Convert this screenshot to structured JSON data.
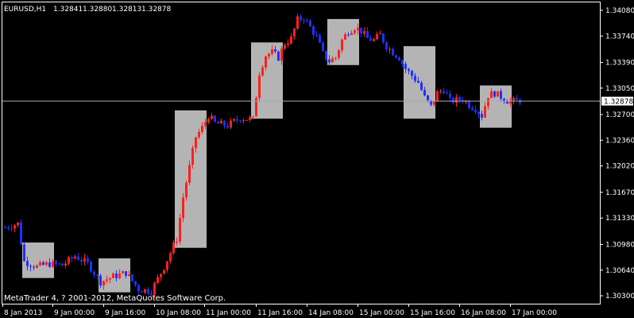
{
  "header": {
    "symbol": "EURUSD,H1",
    "open": "1.32841",
    "high": "1.32880",
    "low": "1.32813",
    "close": "1.32878"
  },
  "footer": {
    "copyright": "MetaTrader 4, ? 2001-2012, MetaQuotes Software Corp."
  },
  "colors": {
    "background": "#000000",
    "bull": "#ff2020",
    "bear": "#2030ff",
    "axis": "#ffffff",
    "zone": "#b4b4b4",
    "current_line": "#aaaaaa"
  },
  "chart_data": {
    "type": "candlestick",
    "y_axis_labels": [
      "1.34080",
      "1.33740",
      "1.33390",
      "1.33050",
      "1.32700",
      "1.32360",
      "1.32020",
      "1.31670",
      "1.31330",
      "1.30980",
      "1.30640",
      "1.30300"
    ],
    "ylim": [
      1.3019,
      1.3418
    ],
    "x_axis_labels": [
      "8 Jan 2013",
      "9 Jan 00:00",
      "9 Jan 16:00",
      "10 Jan 08:00",
      "11 Jan 00:00",
      "11 Jan 16:00",
      "14 Jan 08:00",
      "15 Jan 00:00",
      "15 Jan 16:00",
      "16 Jan 08:00",
      "17 Jan 00:00"
    ],
    "current_price": "1.32878",
    "grid": false,
    "zones": [
      {
        "bar_start": 6,
        "bar_end": 15,
        "high": 1.31,
        "low": 1.3053
      },
      {
        "bar_start": 30,
        "bar_end": 39,
        "high": 1.3079,
        "low": 1.3034
      },
      {
        "bar_start": 54,
        "bar_end": 63,
        "high": 1.3275,
        "low": 1.3093
      },
      {
        "bar_start": 78,
        "bar_end": 87,
        "high": 1.3365,
        "low": 1.3264
      },
      {
        "bar_start": 102,
        "bar_end": 111,
        "high": 1.3396,
        "low": 1.3335
      },
      {
        "bar_start": 126,
        "bar_end": 135,
        "high": 1.336,
        "low": 1.3264
      },
      {
        "bar_start": 150,
        "bar_end": 159,
        "high": 1.3308,
        "low": 1.3252
      }
    ],
    "price_path": [
      [
        0,
        1.312
      ],
      [
        4,
        1.3125
      ],
      [
        6,
        1.3075
      ],
      [
        10,
        1.3068
      ],
      [
        14,
        1.3072
      ],
      [
        18,
        1.307
      ],
      [
        22,
        1.3082
      ],
      [
        26,
        1.3072
      ],
      [
        30,
        1.3048
      ],
      [
        34,
        1.3055
      ],
      [
        38,
        1.306
      ],
      [
        42,
        1.3038
      ],
      [
        46,
        1.3036
      ],
      [
        50,
        1.3068
      ],
      [
        54,
        1.3105
      ],
      [
        56,
        1.316
      ],
      [
        60,
        1.324
      ],
      [
        62,
        1.3252
      ],
      [
        64,
        1.3268
      ],
      [
        66,
        1.3258
      ],
      [
        70,
        1.3255
      ],
      [
        74,
        1.3265
      ],
      [
        78,
        1.3263
      ],
      [
        80,
        1.3325
      ],
      [
        82,
        1.3348
      ],
      [
        84,
        1.3352
      ],
      [
        86,
        1.3345
      ],
      [
        88,
        1.3364
      ],
      [
        90,
        1.337
      ],
      [
        92,
        1.3395
      ],
      [
        94,
        1.3398
      ],
      [
        96,
        1.3385
      ],
      [
        98,
        1.3372
      ],
      [
        100,
        1.335
      ],
      [
        102,
        1.334
      ],
      [
        104,
        1.3345
      ],
      [
        106,
        1.3368
      ],
      [
        108,
        1.338
      ],
      [
        110,
        1.3385
      ],
      [
        112,
        1.338
      ],
      [
        114,
        1.337
      ],
      [
        116,
        1.3368
      ],
      [
        118,
        1.3375
      ],
      [
        120,
        1.336
      ],
      [
        122,
        1.3352
      ],
      [
        124,
        1.3345
      ],
      [
        126,
        1.333
      ],
      [
        130,
        1.3312
      ],
      [
        132,
        1.3292
      ],
      [
        134,
        1.328
      ],
      [
        136,
        1.3298
      ],
      [
        138,
        1.3303
      ],
      [
        140,
        1.3287
      ],
      [
        144,
        1.329
      ],
      [
        146,
        1.3282
      ],
      [
        148,
        1.3278
      ],
      [
        150,
        1.3268
      ],
      [
        152,
        1.3295
      ],
      [
        154,
        1.3298
      ],
      [
        156,
        1.3293
      ],
      [
        158,
        1.3288
      ],
      [
        160,
        1.3287
      ],
      [
        162,
        1.3288
      ]
    ],
    "total_bars": 163
  }
}
